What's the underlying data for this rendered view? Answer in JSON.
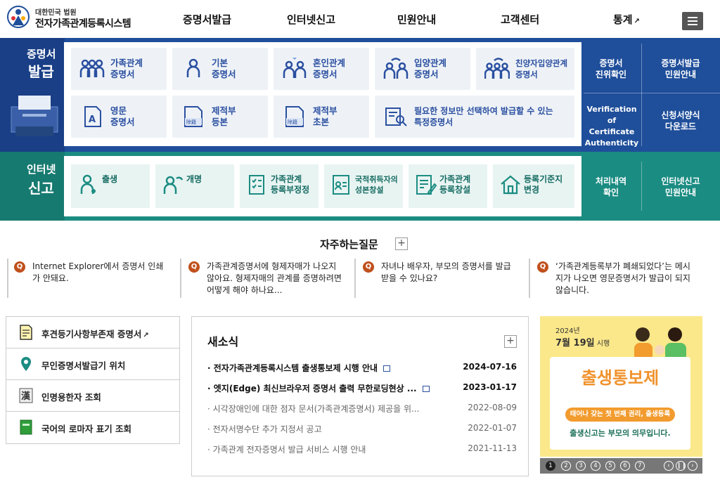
{
  "header": {
    "logo_subtitle": "대한민국 법원",
    "logo_title": "전자가족관계등록시스템",
    "nav": [
      "증명서발급",
      "인터넷신고",
      "민원안내",
      "고객센터",
      "통계"
    ]
  },
  "cert": {
    "title_line1": "증명서",
    "title_line2": "발급",
    "cards": [
      {
        "line1": "가족관계",
        "line2": "증명서"
      },
      {
        "line1": "기본",
        "line2": "증명서"
      },
      {
        "line1": "혼인관계",
        "line2": "증명서"
      },
      {
        "line1": "입양관계",
        "line2": "증명서"
      },
      {
        "line1": "친양자입양관계",
        "line2": "증명서"
      },
      {
        "line1": "영문",
        "line2": "증명서"
      },
      {
        "line1": "제적부",
        "line2": "등본"
      },
      {
        "line1": "제적부",
        "line2": "초본"
      },
      {
        "line1": "필요한 정보만 선택하여 발급할 수 있는",
        "line2": "특정증명서"
      }
    ],
    "side": {
      "verify_1": "증명서",
      "verify_2": "진위확인",
      "guide_1": "증명서발급",
      "guide_2": "민원안내",
      "verif_en_1": "Verification of",
      "verif_en_2": "Certificate",
      "verif_en_3": "Authenticity",
      "download_1": "신청서양식",
      "download_2": "다운로드"
    }
  },
  "report": {
    "title_line1": "인터넷",
    "title_line2": "신고",
    "cards": [
      {
        "line1": "출생",
        "line2": ""
      },
      {
        "line1": "개명",
        "line2": ""
      },
      {
        "line1": "가족관계",
        "line2": "등록부정정"
      },
      {
        "line1": "국적취득자의",
        "line2": "성본창설"
      },
      {
        "line1": "가족관계",
        "line2": "등록창설"
      },
      {
        "line1": "등록기준지",
        "line2": "변경"
      }
    ],
    "side": {
      "history_1": "처리내역",
      "history_2": "확인",
      "guide_1": "인터넷신고",
      "guide_2": "민원안내"
    }
  },
  "faq": {
    "title": "자주하는질문",
    "more": "+",
    "items": [
      {
        "q": "Q",
        "text": "Internet Explorer에서 증명서 인쇄가 안돼요."
      },
      {
        "q": "Q",
        "text": "가족관계증명서에 형제자매가 나오지 않아요. 형제자매의 관계를 증명하려면 어떻게 해야 하나요..."
      },
      {
        "q": "Q",
        "text": "자녀나 배우자, 부모의 증명서를 발급 받을 수 있나요?"
      },
      {
        "q": "Q",
        "text": "‘가족관계등록부가 폐쇄되었다’는 메시지가 나오면 영문증명서가 발급이 되지 않습니다."
      }
    ]
  },
  "quick_links": [
    "후견등기사항부존재 증명서",
    "무인증명서발급기 위치",
    "인명용한자 조회",
    "국어의 로마자 표기 조회"
  ],
  "news": {
    "title": "새소식",
    "more": "+",
    "items": [
      {
        "title": "전자가족관계등록시스템 출생통보제 시행 안내",
        "date": "2024-07-16",
        "is_new": true
      },
      {
        "title": "엣지(Edge) 최신브라우저 증명서 출력 무한로딩현상 ...",
        "date": "2023-01-17",
        "is_new": true
      },
      {
        "title": "시각장애인에 대한 점자 문서(가족관계증명서) 제공을 위...",
        "date": "2022-08-09",
        "is_new": false
      },
      {
        "title": "전자서명수단 추가 지정서 공고",
        "date": "2022-01-07",
        "is_new": false
      },
      {
        "title": "가족관계 전자증명서 발급 서비스 시행 안내",
        "date": "2021-11-13",
        "is_new": false
      }
    ]
  },
  "banner": {
    "year": "2024년",
    "date": "7월 19일",
    "date_suffix": "시행",
    "headline": "출생통보제",
    "pill": "태어나 갖는 첫 번째 권리, 출생등록",
    "duty": "출생신고는 부모의 의무입니다.",
    "pages": [
      "1",
      "2",
      "3",
      "4",
      "5",
      "6",
      "7"
    ],
    "current_page": 1
  },
  "colors": {
    "cert_band": "#1f4e9a",
    "report_band": "#1b8c82",
    "faq_q": "#c0501d",
    "banner_bg": "#fbe88a"
  }
}
